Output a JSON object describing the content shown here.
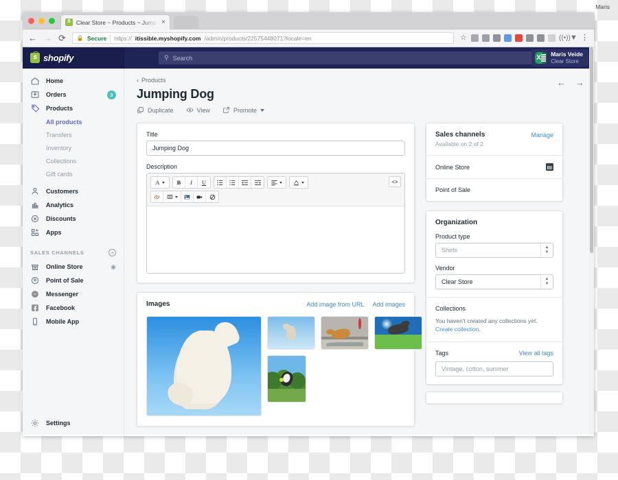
{
  "browser": {
    "tab": {
      "title": "Clear Store ~ Products ~ Jump",
      "close": "×",
      "favicon_name": "shopify-favicon"
    },
    "nav": {
      "back": "←",
      "forward": "→",
      "reload": "⟳"
    },
    "omnibox": {
      "lock": "🔒",
      "secure_label": "Secure",
      "url_prefix": "https://",
      "url_domain": "itissible.myshopify.com",
      "url_path": "/admin/products/22575448071?locale=en"
    },
    "extensions": {
      "star": "☆",
      "audio": "((•))",
      "funnel": "▼",
      "menu": "⋮"
    },
    "os_label": "Maris"
  },
  "topbar": {
    "brand": "shopify",
    "search": {
      "placeholder": "Search",
      "icon": "search-icon"
    },
    "user": {
      "name": "Maris Veide",
      "store": "Clear Store"
    }
  },
  "sidebar": {
    "items": [
      {
        "label": "Home",
        "icon": "home-icon",
        "badge": null
      },
      {
        "label": "Orders",
        "icon": "orders-icon",
        "badge": "3"
      },
      {
        "label": "Products",
        "icon": "products-tag-icon",
        "badge": null
      }
    ],
    "subitems": [
      {
        "label": "All products",
        "active": true
      },
      {
        "label": "Transfers",
        "active": false
      },
      {
        "label": "Inventory",
        "active": false
      },
      {
        "label": "Collections",
        "active": false
      },
      {
        "label": "Gift cards",
        "active": false
      }
    ],
    "items2": [
      {
        "label": "Customers",
        "icon": "customers-icon"
      },
      {
        "label": "Analytics",
        "icon": "analytics-icon"
      },
      {
        "label": "Discounts",
        "icon": "discounts-icon"
      },
      {
        "label": "Apps",
        "icon": "apps-icon"
      }
    ],
    "section": {
      "title": "SALES CHANNELS",
      "add": "+"
    },
    "channels": [
      {
        "label": "Online Store",
        "icon": "store-icon",
        "eye": "◉"
      },
      {
        "label": "Point of Sale",
        "icon": "location-pin-icon",
        "eye": null
      },
      {
        "label": "Messenger",
        "icon": "messenger-icon",
        "eye": null
      },
      {
        "label": "Facebook",
        "icon": "facebook-icon",
        "eye": null
      },
      {
        "label": "Mobile App",
        "icon": "mobile-app-icon",
        "eye": null
      }
    ],
    "settings": {
      "label": "Settings",
      "icon": "gear-icon"
    }
  },
  "main": {
    "breadcrumb": {
      "chevron": "‹",
      "label": "Products"
    },
    "page_title": "Jumping Dog",
    "actions": [
      {
        "label": "Duplicate",
        "icon": "duplicate-icon"
      },
      {
        "label": "View",
        "icon": "eye-icon"
      },
      {
        "label": "Promote",
        "icon": "external-link-icon",
        "has_caret": true
      }
    ],
    "pager": {
      "prev": "←",
      "next": "→"
    },
    "title_field": {
      "label": "Title",
      "value": "Jumping Dog"
    },
    "description": {
      "label": "Description",
      "toolbar_row1": [
        {
          "name": "font-color-icon",
          "glyph": "A",
          "caret": true
        },
        {
          "name": "bold-icon",
          "glyph": "B"
        },
        {
          "name": "italic-icon",
          "glyph": "I"
        },
        {
          "name": "underline-icon",
          "glyph": "U"
        },
        {
          "name": "bulleted-list-icon",
          "glyph": "☰"
        },
        {
          "name": "numbered-list-icon",
          "glyph": "☰"
        },
        {
          "name": "outdent-icon",
          "glyph": "⇤"
        },
        {
          "name": "indent-icon",
          "glyph": "⇥"
        },
        {
          "name": "align-icon",
          "glyph": "≡",
          "caret": true
        },
        {
          "name": "highlight-icon",
          "glyph": "A",
          "caret": true
        }
      ],
      "toolbar_row2": [
        {
          "name": "link-icon",
          "glyph": "🔗"
        },
        {
          "name": "table-icon",
          "glyph": "▦",
          "caret": true
        },
        {
          "name": "insert-image-icon",
          "glyph": "🖼"
        },
        {
          "name": "insert-video-icon",
          "glyph": "▶"
        },
        {
          "name": "clear-formatting-icon",
          "glyph": "⊘"
        }
      ],
      "code_button": {
        "name": "html-code-icon",
        "glyph": "<>"
      },
      "content": ""
    },
    "images": {
      "title": "Images",
      "links": [
        "Add image from URL",
        "Add images"
      ],
      "thumbnails": [
        {
          "name": "white-dog-jumping-blue-sky",
          "size": "large"
        },
        {
          "name": "small-dog-midair",
          "size": "small"
        },
        {
          "name": "dog-leaping-over-ramp",
          "size": "small"
        },
        {
          "name": "dog-flying-over-field",
          "size": "small"
        },
        {
          "name": "dog-catching-ball-park",
          "size": "tall"
        }
      ]
    }
  },
  "right": {
    "sales_channels": {
      "title": "Sales channels",
      "manage_link": "Manage",
      "subtitle": "Available on 2 of 2",
      "rows": [
        {
          "label": "Online Store",
          "icon": "calendar-icon"
        },
        {
          "label": "Point of Sale",
          "icon": null
        }
      ]
    },
    "organization": {
      "title": "Organization",
      "product_type": {
        "label": "Product type",
        "placeholder": "Shirts",
        "value": ""
      },
      "vendor": {
        "label": "Vendor",
        "value": "Clear Store"
      },
      "collections": {
        "label": "Collections",
        "empty_text": "You haven't created any collections yet.",
        "create_link": "Create collection."
      },
      "tags": {
        "label": "Tags",
        "view_all_link": "View all tags",
        "placeholder": "Vintage, cotton, summer",
        "value": ""
      }
    }
  },
  "colors": {
    "navbar": "#1f2457",
    "brand_green": "#95bf47",
    "accent_indigo": "#5c6ac4",
    "link_blue": "#3f8ed0",
    "badge_teal": "#47c1bf"
  }
}
